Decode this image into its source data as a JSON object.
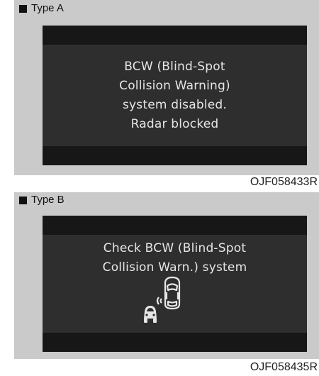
{
  "type_a": {
    "label": "Type A",
    "message_lines": [
      "BCW (Blind-Spot",
      "Collision Warning)",
      "system disabled.",
      "Radar blocked"
    ],
    "code": "OJF058433R"
  },
  "type_b": {
    "label": "Type B",
    "message_lines": [
      "Check BCW (Blind-Spot",
      "Collision Warn.) system"
    ],
    "icon": "blind-spot-cars-icon",
    "code": "OJF058435R"
  },
  "colors": {
    "panel_bg": "#cacaca",
    "screen_bg": "#2e2e2e",
    "screen_bar": "#171717",
    "screen_text": "#e6e6e6"
  }
}
